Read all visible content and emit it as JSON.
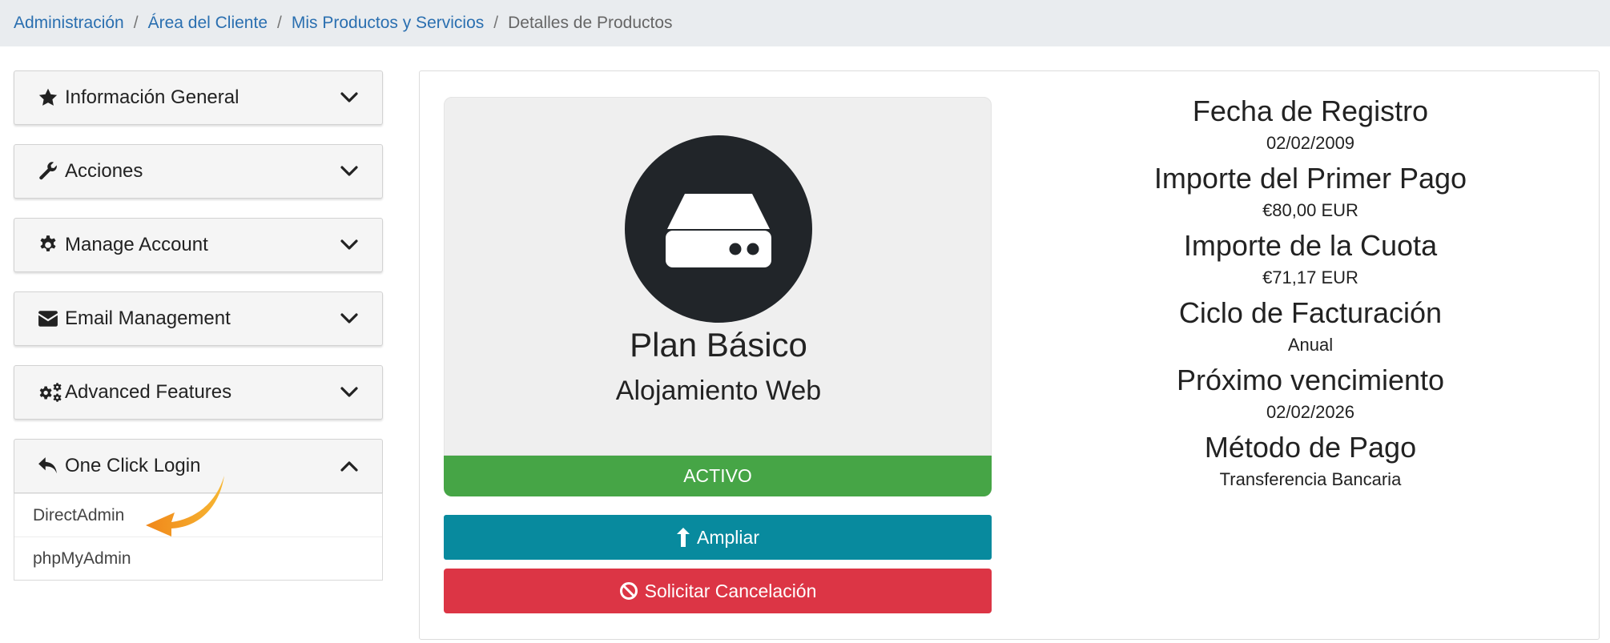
{
  "breadcrumb": {
    "items": [
      "Administración",
      "Área del Cliente",
      "Mis Productos y Servicios"
    ],
    "current": "Detalles de Productos"
  },
  "sidebar": {
    "panels": [
      {
        "label": "Información General",
        "icon": "star-icon"
      },
      {
        "label": "Acciones",
        "icon": "wrench-icon"
      },
      {
        "label": "Manage Account",
        "icon": "gear-icon"
      },
      {
        "label": "Email Management",
        "icon": "envelope-icon"
      },
      {
        "label": "Advanced Features",
        "icon": "gears-icon"
      },
      {
        "label": "One Click Login",
        "icon": "reply-icon"
      }
    ],
    "login_items": [
      "DirectAdmin",
      "phpMyAdmin"
    ]
  },
  "product": {
    "name": "Plan Básico",
    "type": "Alojamiento Web",
    "status": "ACTIVO",
    "upgrade_label": "Ampliar",
    "cancel_label": "Solicitar Cancelación",
    "icon": "hdd-icon"
  },
  "details": [
    {
      "label": "Fecha de Registro",
      "value": "02/02/2009"
    },
    {
      "label": "Importe del Primer Pago",
      "value": "€80,00 EUR"
    },
    {
      "label": "Importe de la Cuota",
      "value": "€71,17 EUR"
    },
    {
      "label": "Ciclo de Facturación",
      "value": "Anual"
    },
    {
      "label": "Próximo vencimiento",
      "value": "02/02/2026"
    },
    {
      "label": "Método de Pago",
      "value": "Transferencia Bancaria"
    }
  ],
  "colors": {
    "link": "#2a6fb0",
    "status_active": "#46a546",
    "upgrade": "#088a9e",
    "cancel": "#dc3545",
    "arrow": "#f39c1a"
  }
}
